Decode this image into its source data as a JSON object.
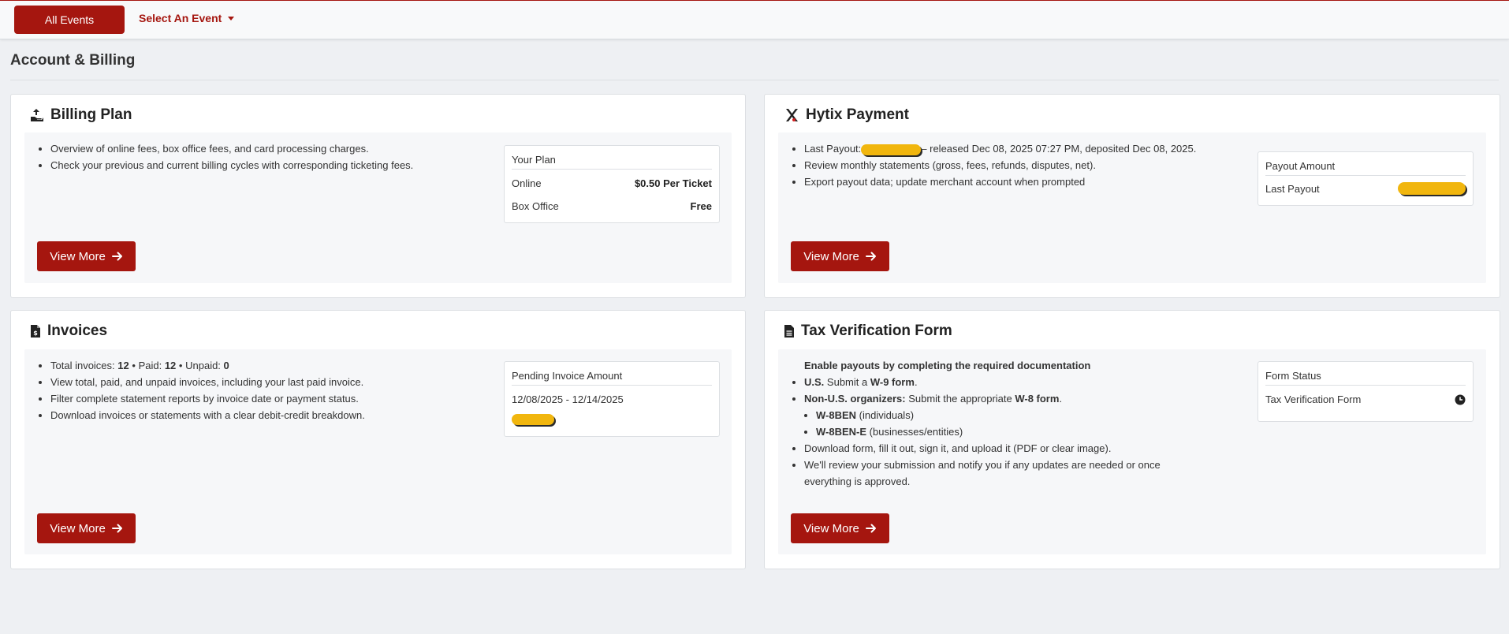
{
  "topbar": {
    "all_events_label": "All Events",
    "select_event_label": "Select An Event"
  },
  "page": {
    "title": "Account & Billing"
  },
  "colors": {
    "brand": "#a5160f",
    "redaction": "#f1b60e"
  },
  "billing": {
    "title": "Billing Plan",
    "icon": "hand-holding-upload-icon",
    "bullets": [
      "Overview of online fees, box office fees, and card processing charges.",
      "Check your previous and current billing cycles with corresponding ticketing fees."
    ],
    "box_title": "Your Plan",
    "rows": [
      {
        "label": "Online",
        "value": "$0.50 Per Ticket"
      },
      {
        "label": "Box Office",
        "value": "Free"
      }
    ],
    "button_label": "View More"
  },
  "payment": {
    "title": "Hytix Payment",
    "icon": "hytix-x-icon",
    "payout_prefix": "Last Payout:",
    "payout_suffix": "– released Dec 08, 2025 07:27 PM, deposited Dec 08, 2025.",
    "bullets": [
      "Review monthly statements (gross, fees, refunds, disputes, net).",
      "Export payout data; update merchant account when prompted"
    ],
    "box_title": "Payout Amount",
    "row_label": "Last Payout",
    "button_label": "View More"
  },
  "invoices": {
    "title": "Invoices",
    "icon": "invoice-dollar-icon",
    "totals": {
      "total_label": "Total invoices:",
      "total_value": "12",
      "sep": "•",
      "paid_label": "Paid:",
      "paid_value": "12",
      "unpaid_label": "Unpaid:",
      "unpaid_value": "0"
    },
    "bullets": [
      "View total, paid, and unpaid invoices, including your last paid invoice.",
      "Filter complete statement reports by invoice date or payment status.",
      "Download invoices or statements with a clear debit-credit breakdown."
    ],
    "box_title": "Pending Invoice Amount",
    "date_range": "12/08/2025 - 12/14/2025",
    "button_label": "View More"
  },
  "tax": {
    "title": "Tax Verification Form",
    "icon": "document-icon",
    "lead": "Enable payouts by completing the required documentation",
    "us_label": "U.S.",
    "us_text": "Submit a",
    "us_form": "W-9 form",
    "us_end": ".",
    "non_us_label": "Non-U.S. organizers:",
    "non_us_text": "Submit the appropriate",
    "non_us_form": "W-8 form",
    "non_us_end": ".",
    "sub_items": [
      {
        "code": "W-8BEN",
        "desc": "(individuals)"
      },
      {
        "code": "W-8BEN-E",
        "desc": "(businesses/entities)"
      }
    ],
    "bullets": [
      "Download form, fill it out, sign it, and upload it (PDF or clear image).",
      "We'll review your submission and notify you if any updates are needed or once everything is approved."
    ],
    "box_title": "Form Status",
    "row_label": "Tax Verification Form",
    "status_icon": "clock-icon",
    "button_label": "View More"
  }
}
